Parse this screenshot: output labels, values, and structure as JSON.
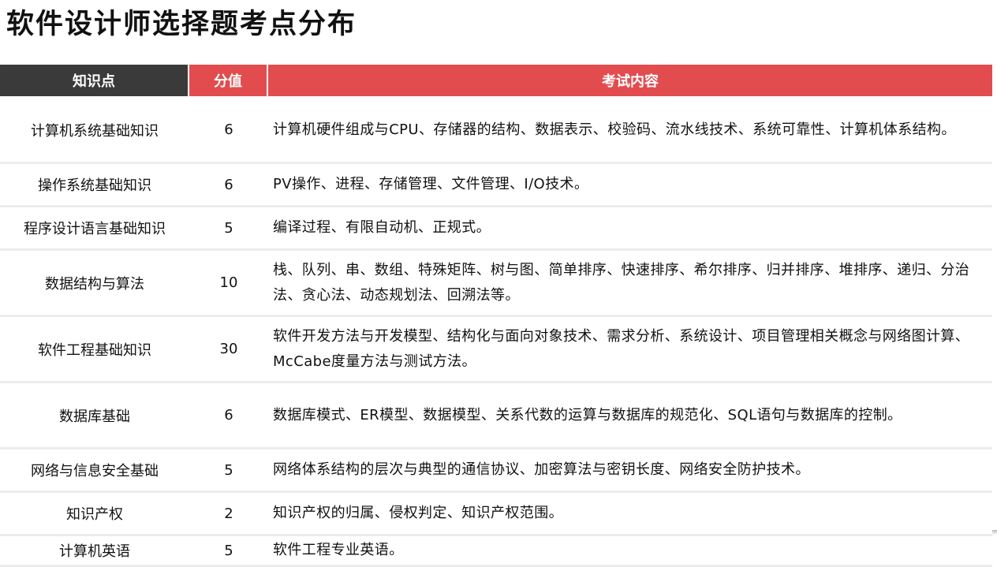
{
  "title": "软件设计师选择题考点分布",
  "table": {
    "headers": [
      "知识点",
      "分值",
      "考试内容"
    ],
    "rows": [
      {
        "area": "计算机系统基础知识",
        "score": "6",
        "content": "计算机硬件组成与CPU、存储器的结构、数据表示、校验码、流水线技术、系统可靠性、计算机体系结构。"
      },
      {
        "area": "操作系统基础知识",
        "score": "6",
        "content": "PV操作、进程、存储管理、文件管理、I/O技术。"
      },
      {
        "area": "程序设计语言基础知识",
        "score": "5",
        "content": "编译过程、有限自动机、正规式。"
      },
      {
        "area": "数据结构与算法",
        "score": "10",
        "content": "栈、队列、串、数组、特殊矩阵、树与图、简单排序、快速排序、希尔排序、归并排序、堆排序、递归、分治法、贪心法、动态规划法、回溯法等。"
      },
      {
        "area": "软件工程基础知识",
        "score": "30",
        "content": "软件开发方法与开发模型、结构化与面向对象技术、需求分析、系统设计、项目管理相关概念与网络图计算、McCabe度量方法与测试方法。"
      },
      {
        "area": "数据库基础",
        "score": "6",
        "content": "数据库模式、ER模型、数据模型、关系代数的运算与数据库的规范化、SQL语句与数据库的控制。"
      },
      {
        "area": "网络与信息安全基础",
        "score": "5",
        "content": "网络体系结构的层次与典型的通信协议、加密算法与密钥长度、网络安全防护技术。"
      },
      {
        "area": "知识产权",
        "score": "2",
        "content": "知识产权的归属、侵权判定、知识产权范围。"
      },
      {
        "area": "计算机英语",
        "score": "5",
        "content": "软件工程专业英语。"
      }
    ]
  },
  "colors": {
    "header_dark": "#3a3a3a",
    "header_accent": "#e24c4f",
    "row_divider": "#ececec"
  }
}
